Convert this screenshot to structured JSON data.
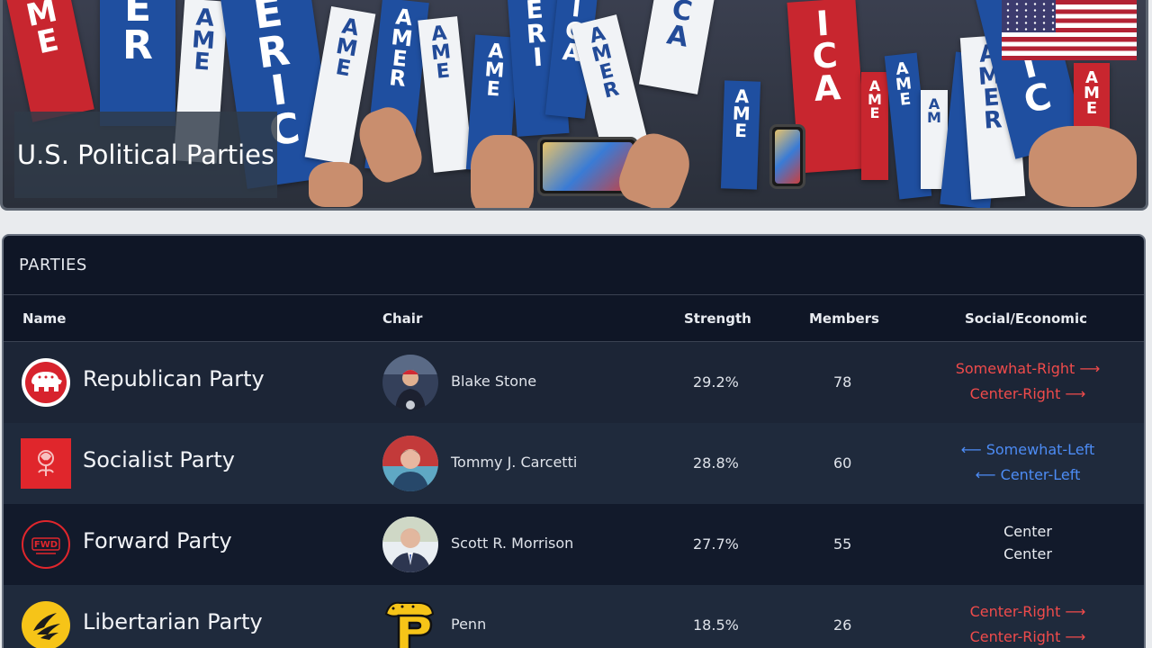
{
  "banner": {
    "title": "U.S. Political Parties",
    "flag_icon": "us-flag-icon",
    "sign_words": [
      "AMERICA",
      "AMERICA",
      "AMERICA"
    ]
  },
  "panel": {
    "heading": "PARTIES",
    "columns": {
      "name": "Name",
      "chair": "Chair",
      "strength": "Strength",
      "members": "Members",
      "social_economic": "Social/Economic"
    },
    "rows": [
      {
        "name": "Republican Party",
        "logo_icon": "elephant-logo-icon",
        "chair": "Blake Stone",
        "strength": "29.2%",
        "members": "78",
        "social": "Somewhat-Right ⟶",
        "economic": "Center-Right ⟶",
        "lean_color": "#f04b4b"
      },
      {
        "name": "Socialist Party",
        "logo_icon": "rose-logo-icon",
        "chair": "Tommy J. Carcetti",
        "strength": "28.8%",
        "members": "60",
        "social": "⟵ Somewhat-Left",
        "economic": "⟵ Center-Left",
        "lean_color": "#4d8cf5"
      },
      {
        "name": "Forward Party",
        "logo_icon": "fwd-logo-icon",
        "chair": "Scott R. Morrison",
        "strength": "27.7%",
        "members": "55",
        "social": "Center",
        "economic": "Center",
        "lean_color": "#e8ebf0"
      },
      {
        "name": "Libertarian Party",
        "logo_icon": "torch-logo-icon",
        "chair": "Penn",
        "strength": "18.5%",
        "members": "26",
        "social": "Center-Right ⟶",
        "economic": "Center-Right ⟶",
        "lean_color": "#f04b4b"
      }
    ]
  },
  "colors": {
    "panel_bg": "#0f1626",
    "row_alt": "#1c2536",
    "right": "#f04b4b",
    "left": "#4d8cf5"
  }
}
